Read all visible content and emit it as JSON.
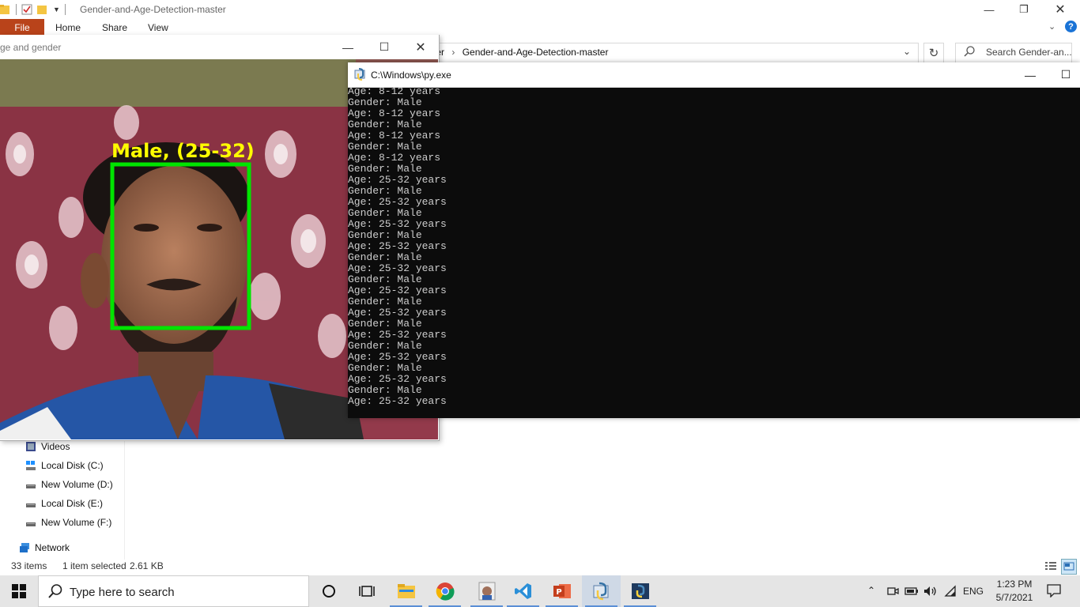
{
  "explorer": {
    "title": "Gender-and-Age-Detection-master",
    "ribbon_tabs": {
      "file": "File",
      "home": "Home",
      "share": "Share",
      "view": "View"
    },
    "address": {
      "prefix": "ter",
      "separator": "›",
      "current": "Gender-and-Age-Detection-master"
    },
    "search_placeholder": "Search Gender-an...",
    "nav_items": [
      "Videos",
      "Local Disk (C:)",
      "New Volume (D:)",
      "Local Disk (E:)",
      "New Volume (F:)"
    ],
    "network": "Network",
    "status": {
      "items": "33 items",
      "selected": "1 item selected",
      "size": "2.61 KB"
    }
  },
  "cv_window": {
    "title": "ge and gender",
    "overlay_label": "Male, (25-32)",
    "label_color": "#ffff00",
    "box_color": "#00e400"
  },
  "console": {
    "title": "C:\\Windows\\py.exe",
    "lines": [
      "Age: 8-12 years",
      "Gender: Male",
      "Age: 8-12 years",
      "Gender: Male",
      "Age: 8-12 years",
      "Gender: Male",
      "Age: 8-12 years",
      "Gender: Male",
      "Age: 25-32 years",
      "Gender: Male",
      "Age: 25-32 years",
      "Gender: Male",
      "Age: 25-32 years",
      "Gender: Male",
      "Age: 25-32 years",
      "Gender: Male",
      "Age: 25-32 years",
      "Gender: Male",
      "Age: 25-32 years",
      "Gender: Male",
      "Age: 25-32 years",
      "Gender: Male",
      "Age: 25-32 years",
      "Gender: Male",
      "Age: 25-32 years",
      "Gender: Male",
      "Age: 25-32 years",
      "Gender: Male",
      "Age: 25-32 years"
    ]
  },
  "taskbar": {
    "search_placeholder": "Type here to search",
    "apps": [
      "task-view-icon",
      "file-explorer-icon",
      "chrome-icon",
      "photo-icon",
      "vscode-icon",
      "powerpoint-icon",
      "py-launcher-icon",
      "python-icon"
    ],
    "language": "ENG",
    "time": "1:23 PM",
    "date": "5/7/2021"
  }
}
